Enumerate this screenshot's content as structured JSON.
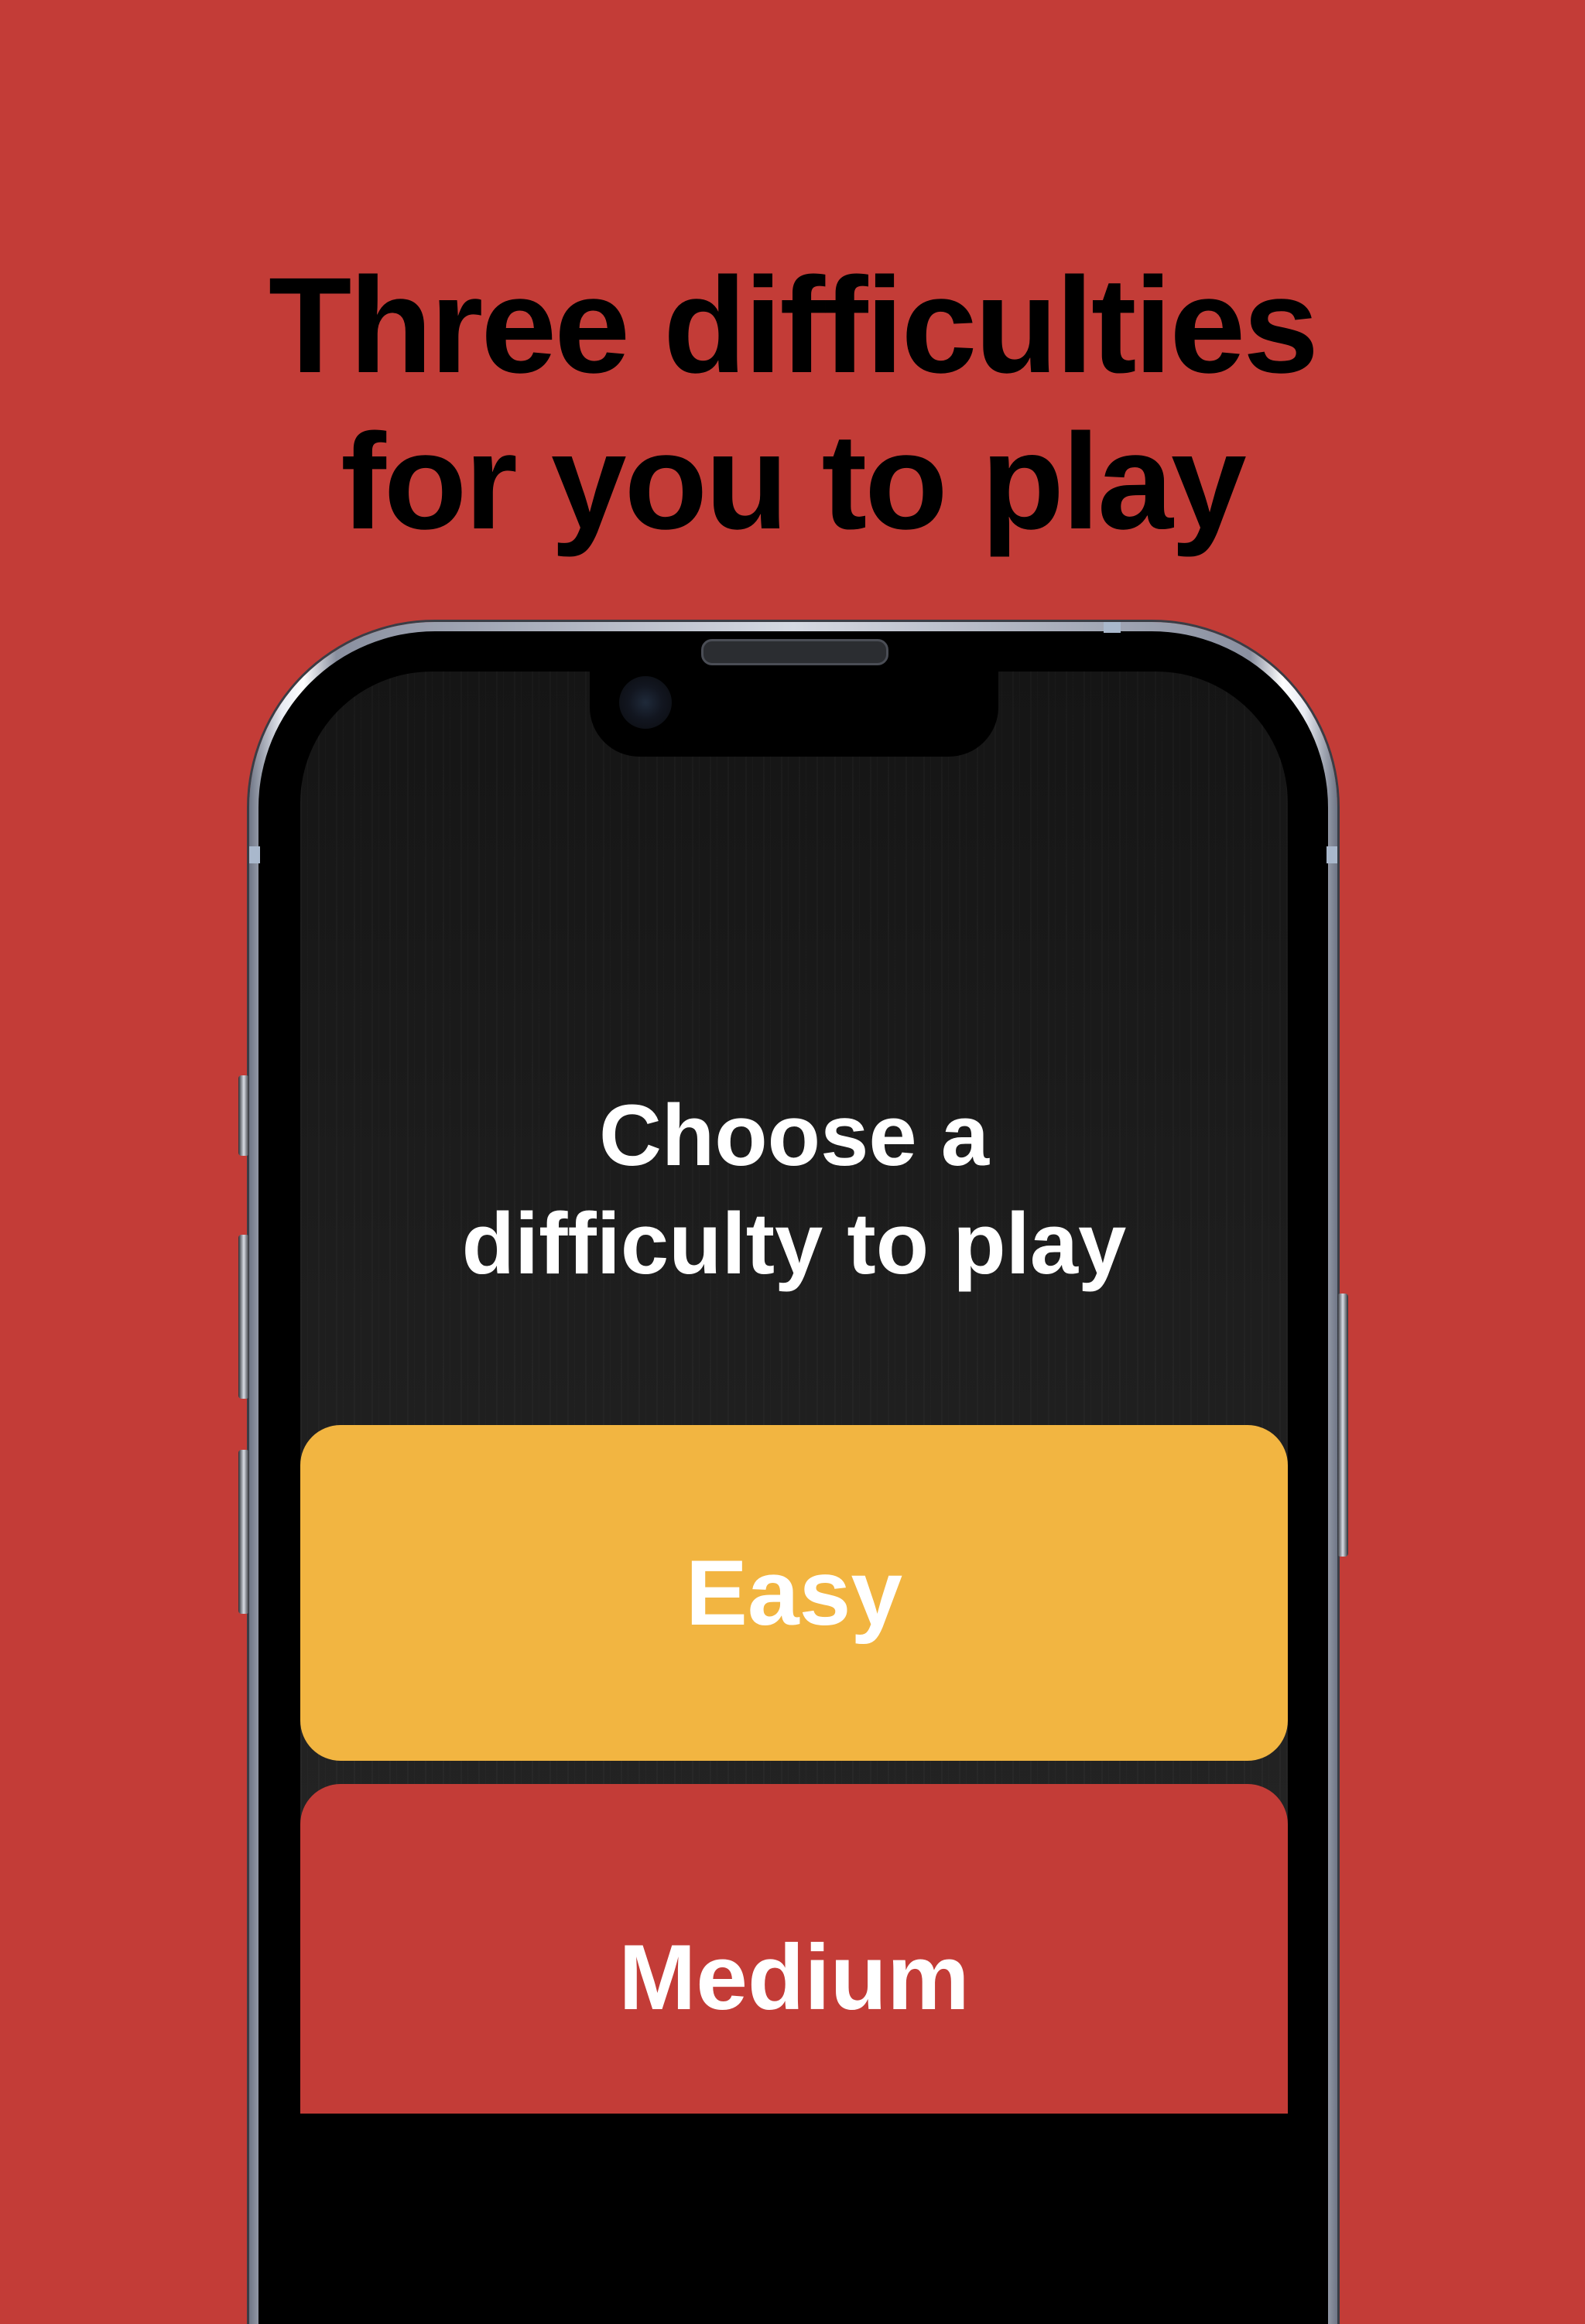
{
  "headline": {
    "line1": "Three difficulties",
    "line2": "for you to play"
  },
  "screen": {
    "prompt_line1": "Choose a",
    "prompt_line2": "difficulty to play",
    "buttons": [
      {
        "label": "Easy",
        "color": "#F2B541"
      },
      {
        "label": "Medium",
        "color": "#C33C37"
      }
    ]
  },
  "colors": {
    "background": "#C33C37",
    "headline_text": "#000000",
    "button_text": "#FFFFFF"
  }
}
